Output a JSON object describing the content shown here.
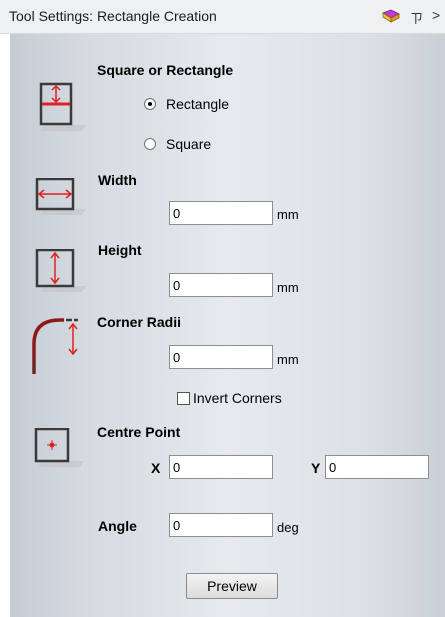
{
  "window": {
    "title": "Tool Settings: Rectangle Creation",
    "pin_glyph": "ㄗ",
    "close_glyph": ">"
  },
  "shape_section": {
    "title": "Square or Rectangle",
    "options": [
      {
        "label": "Rectangle",
        "selected": true
      },
      {
        "label": "Square",
        "selected": false
      }
    ]
  },
  "width": {
    "label": "Width",
    "value": "0",
    "unit": "mm"
  },
  "height": {
    "label": "Height",
    "value": "0",
    "unit": "mm"
  },
  "corner_radii": {
    "label": "Corner Radii",
    "value": "0",
    "unit": "mm",
    "invert_label": "Invert Corners",
    "invert_checked": false
  },
  "centre_point": {
    "label": "Centre Point",
    "x_label": "X",
    "x_value": "0",
    "y_label": "Y",
    "y_value": "0"
  },
  "angle": {
    "label": "Angle",
    "value": "0",
    "unit": "deg"
  },
  "preview_button": "Preview",
  "colors": {
    "accent_red": "#e02020",
    "panel": "#dde1e6"
  }
}
